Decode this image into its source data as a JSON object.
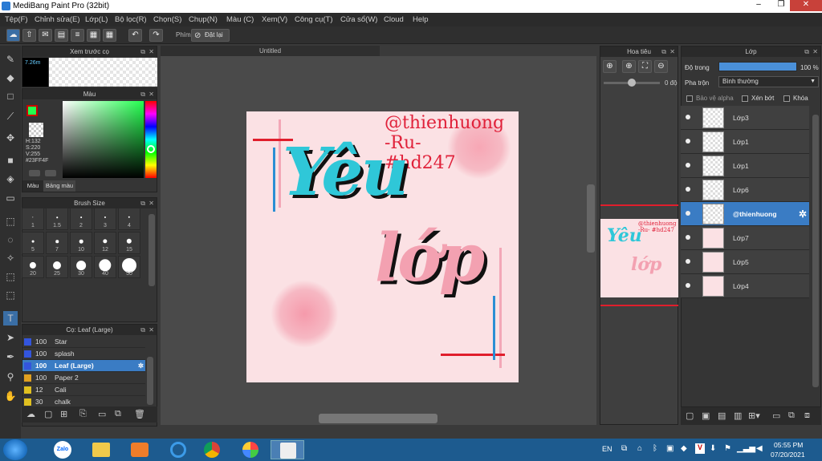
{
  "window": {
    "title": "MediBang Paint Pro (32bit)",
    "min": "–",
    "restore": "❐",
    "close": "✕"
  },
  "menu": [
    "Tệp(F)",
    "Chỉnh sửa(E)",
    "Lớp(L)",
    "Bộ lọc(R)",
    "Chọn(S)",
    "Chụp(N)",
    "Màu (C)",
    "Xem(V)",
    "Công cụ(T)",
    "Cửa sổ(W)",
    "Cloud",
    "Help"
  ],
  "toolbar": {
    "snap_label": "Phím",
    "reset_label": "Đặt lại"
  },
  "preview": {
    "title": "Xem trước cọ",
    "size": "7.26m"
  },
  "color": {
    "title": "Màu",
    "h": "H:132",
    "s": "S:220",
    "v": "V:255",
    "hex": "#23FF4F",
    "tab_color": "Màu",
    "tab_palette": "Bảng màu",
    "fg": "#23ff4f"
  },
  "brush_size": {
    "title": "Brush Size",
    "sizes": [
      "1",
      "1.5",
      "2",
      "3",
      "4",
      "5",
      "7",
      "10",
      "12",
      "15",
      "20",
      "25",
      "30",
      "40",
      "50"
    ]
  },
  "brush_list": {
    "title": "Cọ: Leaf (Large)",
    "items": [
      {
        "size": "100",
        "name": "Star",
        "color": "#3355dd"
      },
      {
        "size": "100",
        "name": "splash",
        "color": "#3355dd"
      },
      {
        "size": "100",
        "name": "Leaf (Large)",
        "color": "#3355dd"
      },
      {
        "size": "100",
        "name": "Paper 2",
        "color": "#e0a020"
      },
      {
        "size": "12",
        "name": "Cali",
        "color": "#e0c020"
      },
      {
        "size": "30",
        "name": "chalk",
        "color": "#e0c020"
      }
    ]
  },
  "canvas": {
    "tab": "Untitled",
    "watermark1": "@thienhuong",
    "watermark2": "-Ru-",
    "watermark3": "#hd247",
    "word1": "Yêu",
    "word2": "lớp"
  },
  "navigator": {
    "title": "Hoa tiêu",
    "angle": "0 độ",
    "mini1": "Yêu",
    "mini2": "lớp",
    "mini_wm": "@thienhuong -Ru- #hd247"
  },
  "layers": {
    "title": "Lớp",
    "opacity_label": "Độ trong",
    "opacity_value": "100 %",
    "blend_label": "Pha trộn",
    "blend_value": "Bình thường",
    "protect_alpha": "Bảo vệ alpha",
    "clip": "Xén bớt",
    "lock": "Khóa",
    "items": [
      "Lớp3",
      "Lớp1",
      "Lớp1",
      "Lớp6",
      "@thienhuong",
      "Lớp7",
      "Lớp5",
      "Lớp4"
    ]
  },
  "taskbar": {
    "lang": "EN",
    "time": "05:55 PM",
    "date": "07/20/2021",
    "zalo": "Zalo"
  }
}
